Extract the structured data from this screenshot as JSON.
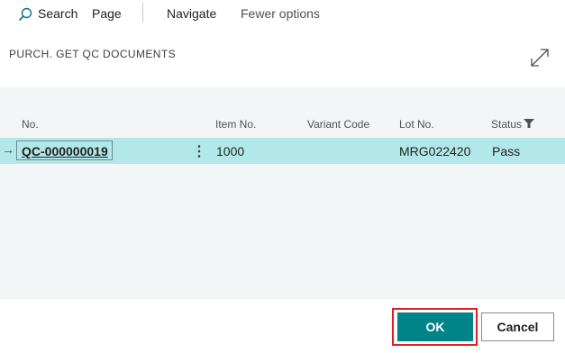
{
  "toolbar": {
    "search_label": "Search",
    "page_label": "Page",
    "navigate_label": "Navigate",
    "fewer_options_label": "Fewer options"
  },
  "dialog": {
    "title": "PURCH. GET QC DOCUMENTS"
  },
  "table": {
    "columns": [
      "No.",
      "Item No.",
      "Variant Code",
      "Lot No.",
      "Status"
    ],
    "rows": [
      {
        "no": "QC-000000019",
        "item_no": "1000",
        "variant_code": "",
        "lot_no": "MRG022420",
        "status": "Pass"
      }
    ]
  },
  "footer": {
    "ok_label": "OK",
    "cancel_label": "Cancel"
  },
  "colors": {
    "accent": "#008489",
    "selected_row": "#b3e8ea",
    "highlight_box": "#e02020"
  },
  "icons": [
    "search-icon",
    "expand-icon",
    "filter-icon",
    "row-arrow-icon",
    "more-options-icon"
  ]
}
